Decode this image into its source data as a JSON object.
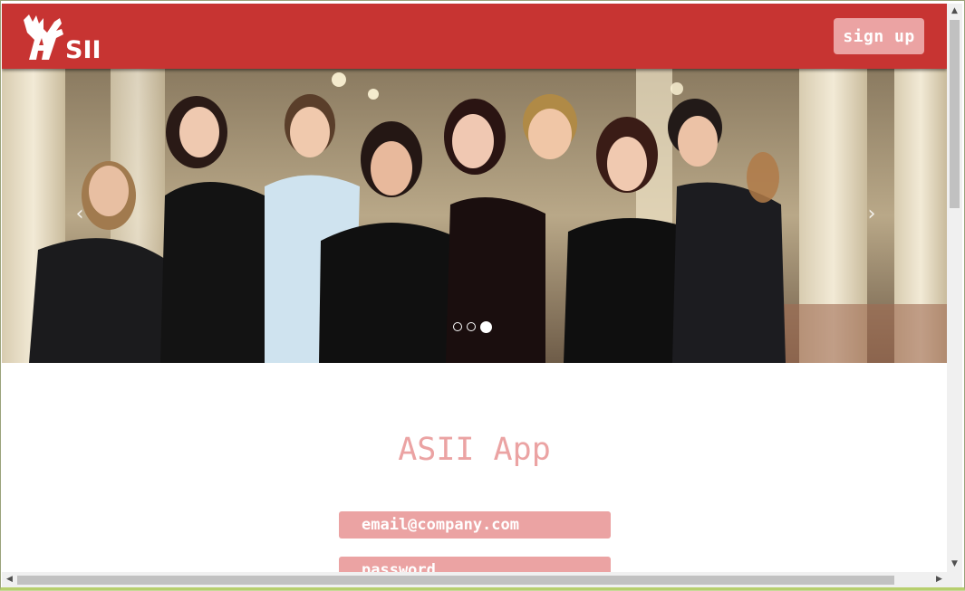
{
  "header": {
    "logo_text": "SII",
    "signup_label": "sign up",
    "colors": {
      "bar": "#c73432",
      "button": "#eba3a3"
    }
  },
  "carousel": {
    "prev_icon": "‹",
    "next_icon": "›",
    "slide_count": 3,
    "active_slide": 3
  },
  "main": {
    "title": "ASII App",
    "email_placeholder": "email@company.com",
    "password_placeholder": "password",
    "accent_color": "#eba3a3"
  },
  "scrollbars": {
    "up_icon": "▲",
    "down_icon": "▼",
    "left_icon": "◀",
    "right_icon": "▶"
  }
}
